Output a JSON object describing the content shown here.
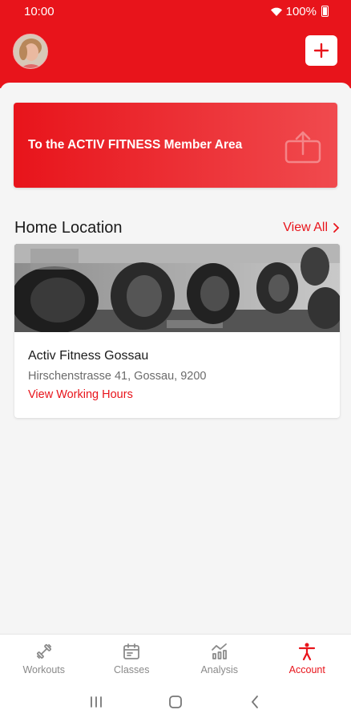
{
  "status_bar": {
    "time": "10:00",
    "battery": "100%"
  },
  "header": {
    "avatar_icon": "user-avatar",
    "add_icon": "plus-icon"
  },
  "member_banner": {
    "label": "To the ACTIV FITNESS Member Area",
    "icon": "share-icon"
  },
  "home_location": {
    "title": "Home Location",
    "view_all_label": "View All",
    "card": {
      "name": "Activ Fitness Gossau",
      "address": "Hirschenstrasse 41, Gossau, 9200",
      "hours_link": "View Working Hours"
    }
  },
  "bottom_nav": {
    "items": [
      {
        "label": "Workouts",
        "icon": "dumbbell-icon",
        "active": false
      },
      {
        "label": "Classes",
        "icon": "calendar-icon",
        "active": false
      },
      {
        "label": "Analysis",
        "icon": "chart-icon",
        "active": false
      },
      {
        "label": "Account",
        "icon": "person-icon",
        "active": true
      }
    ]
  },
  "colors": {
    "brand": "#e8141b",
    "inactive": "#8a8a8a",
    "background": "#f5f5f5"
  }
}
